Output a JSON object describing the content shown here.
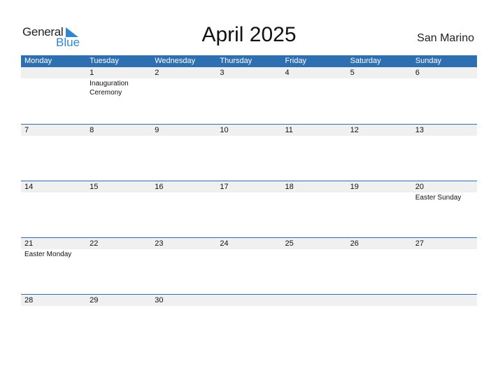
{
  "logo": {
    "general": "General",
    "blue": "Blue"
  },
  "title": "April 2025",
  "country": "San Marino",
  "days": [
    "Monday",
    "Tuesday",
    "Wednesday",
    "Thursday",
    "Friday",
    "Saturday",
    "Sunday"
  ],
  "weeks": [
    {
      "dates": [
        "",
        "1",
        "2",
        "3",
        "4",
        "5",
        "6"
      ],
      "events": [
        "",
        "Inauguration Ceremony",
        "",
        "",
        "",
        "",
        ""
      ]
    },
    {
      "dates": [
        "7",
        "8",
        "9",
        "10",
        "11",
        "12",
        "13"
      ],
      "events": [
        "",
        "",
        "",
        "",
        "",
        "",
        ""
      ]
    },
    {
      "dates": [
        "14",
        "15",
        "16",
        "17",
        "18",
        "19",
        "20"
      ],
      "events": [
        "",
        "",
        "",
        "",
        "",
        "",
        "Easter Sunday"
      ]
    },
    {
      "dates": [
        "21",
        "22",
        "23",
        "24",
        "25",
        "26",
        "27"
      ],
      "events": [
        "Easter Monday",
        "",
        "",
        "",
        "",
        "",
        ""
      ]
    },
    {
      "dates": [
        "28",
        "29",
        "30",
        "",
        "",
        "",
        ""
      ],
      "events": [
        "",
        "",
        "",
        "",
        "",
        "",
        ""
      ]
    }
  ],
  "colors": {
    "header": "#2e6fb1",
    "brand": "#2f86d1",
    "rowbg": "#f0f0f0"
  }
}
